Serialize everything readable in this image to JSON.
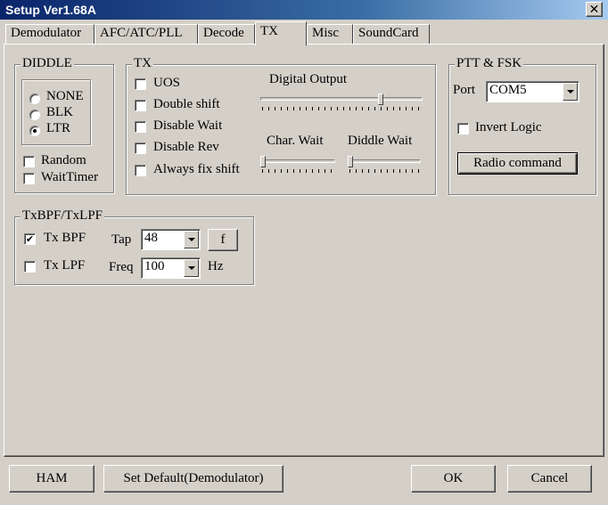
{
  "window": {
    "title": "Setup Ver1.68A",
    "close_glyph": "✕"
  },
  "tabs": [
    "Demodulator",
    "AFC/ATC/PLL",
    "Decode",
    "TX",
    "Misc",
    "SoundCard"
  ],
  "active_tab": "TX",
  "diddle": {
    "title": "DIDDLE",
    "options": [
      "NONE",
      "BLK",
      "LTR"
    ],
    "selected": "LTR",
    "random_label": "Random",
    "random_checked": false,
    "waittimer_label": "WaitTimer",
    "waittimer_checked": false
  },
  "tx": {
    "title": "TX",
    "options": [
      {
        "label": "UOS",
        "checked": false
      },
      {
        "label": "Double shift",
        "checked": false
      },
      {
        "label": "Disable Wait",
        "checked": false
      },
      {
        "label": "Disable Rev",
        "checked": false
      },
      {
        "label": "Always fix shift",
        "checked": false
      }
    ],
    "digital_output_label": "Digital Output",
    "digital_output_level": 0.75,
    "char_wait_label": "Char. Wait",
    "char_wait_level": 0.0,
    "diddle_wait_label": "Diddle Wait",
    "diddle_wait_level": 0.0
  },
  "ptt": {
    "title": "PTT & FSK",
    "port_label": "Port",
    "port_value": "COM5",
    "invert_label": "Invert Logic",
    "invert_checked": false,
    "radio_command_label": "Radio command"
  },
  "txbpf": {
    "title": "TxBPF/TxLPF",
    "bpf_label": "Tx BPF",
    "bpf_checked": true,
    "lpf_label": "Tx LPF",
    "lpf_checked": false,
    "tap_label": "Tap",
    "tap_value": "48",
    "f_button": "f",
    "freq_label": "Freq",
    "freq_value": "100",
    "hz_label": "Hz"
  },
  "footer": {
    "ham": "HAM",
    "set_default": "Set Default(Demodulator)",
    "ok": "OK",
    "cancel": "Cancel"
  }
}
